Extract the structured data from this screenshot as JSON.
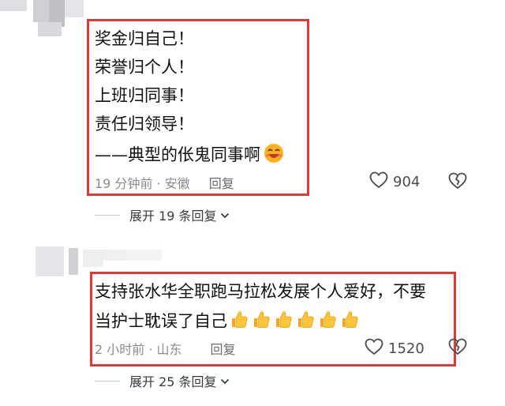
{
  "comment1": {
    "lines": [
      "奖金归自己！",
      "荣誉归个人！",
      "上班归同事！",
      "责任归领导！",
      "——典型的伥鬼同事啊"
    ],
    "emoji_icon": "laughing-face-icon",
    "meta": "19 分钟前 · 安徽",
    "reply_label": "回复",
    "likes": "904",
    "expand_label": "展开 19 条回复"
  },
  "comment2": {
    "lines": [
      "支持张水华全职跑马拉松发展个人爱好，不要",
      "当护士耽误了自己"
    ],
    "emoji_icon": "thumbs-up-icon",
    "thumbs_count": 6,
    "meta": "2 小时前 · 山东",
    "reply_label": "回复",
    "likes": "1520",
    "expand_label": "展开 25 条回复"
  },
  "colors": {
    "highlight_border": "#e53935",
    "meta_text": "#8a8b91",
    "body_text": "#111111"
  }
}
